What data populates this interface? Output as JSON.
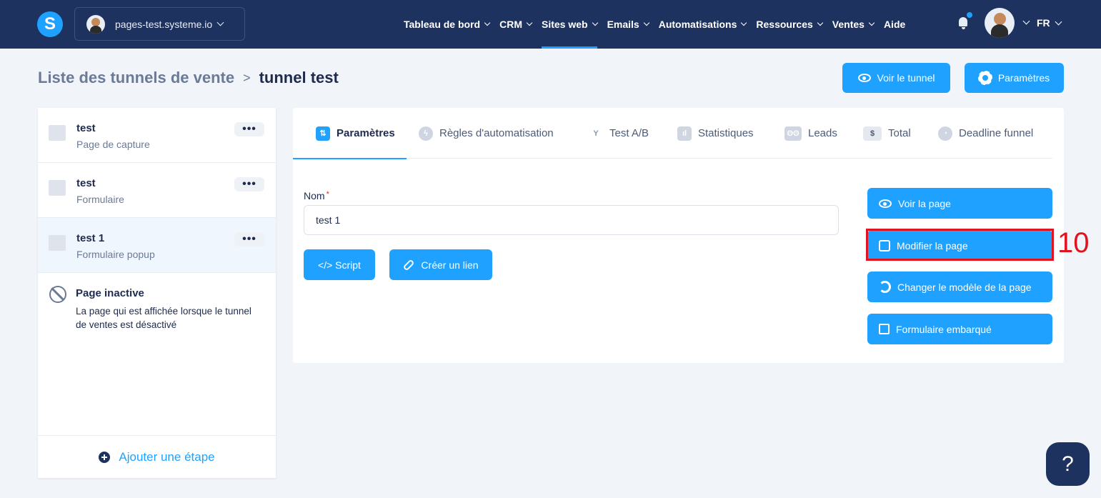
{
  "topbar": {
    "logo_letter": "S",
    "site": "pages-test.systeme.io",
    "nav": [
      {
        "label": "Tableau de bord",
        "chevron": true
      },
      {
        "label": "CRM",
        "chevron": true
      },
      {
        "label": "Sites web",
        "chevron": true,
        "active": true
      },
      {
        "label": "Emails",
        "chevron": true
      },
      {
        "label": "Automatisations",
        "chevron": true
      },
      {
        "label": "Ressources",
        "chevron": true
      },
      {
        "label": "Ventes",
        "chevron": true
      },
      {
        "label": "Aide",
        "chevron": false
      }
    ],
    "language": "FR",
    "colors": {
      "bar": "#1e3260",
      "accent": "#1fa2ff"
    }
  },
  "breadcrumb": {
    "root": "Liste des tunnels de vente",
    "separator": ">",
    "current": "tunnel test"
  },
  "header_buttons": {
    "view_funnel": "Voir le tunnel",
    "settings": "Paramètres"
  },
  "sidebar": {
    "steps": [
      {
        "title": "test",
        "subtitle": "Page de capture",
        "icon": "capture-page-icon"
      },
      {
        "title": "test",
        "subtitle": "Formulaire",
        "icon": "form-page-icon"
      },
      {
        "title": "test 1",
        "subtitle": "Formulaire popup",
        "icon": "popup-page-icon",
        "selected": true
      }
    ],
    "menu_label": "•••",
    "inactive": {
      "title": "Page inactive",
      "description": "La page qui est affichée lorsque le tunnel de ventes est désactivé"
    },
    "add_step": "Ajouter une étape"
  },
  "tabs": [
    {
      "label": "Paramètres",
      "icon": "sliders-icon",
      "active": true
    },
    {
      "label": "Règles d'automatisation",
      "icon": "lightning-icon"
    },
    {
      "label": "Test A/B",
      "icon": "split-icon"
    },
    {
      "label": "Statistiques",
      "icon": "bar-chart-icon"
    },
    {
      "label": "Leads",
      "icon": "users-icon"
    },
    {
      "label": "Total",
      "icon": "dollar-icon"
    },
    {
      "label": "Deadline funnel",
      "icon": "clock-icon"
    }
  ],
  "form": {
    "name_label": "Nom",
    "required_mark": "*",
    "name_value": "test 1",
    "script_button": "</> Script",
    "link_button": "Créer un lien"
  },
  "actions": {
    "view_page": "Voir la page",
    "edit_page": "Modifier la page",
    "change_template": "Changer le modèle de la page",
    "embedded_form": "Formulaire embarqué"
  },
  "annotation": {
    "number": "10"
  },
  "help_label": "?"
}
